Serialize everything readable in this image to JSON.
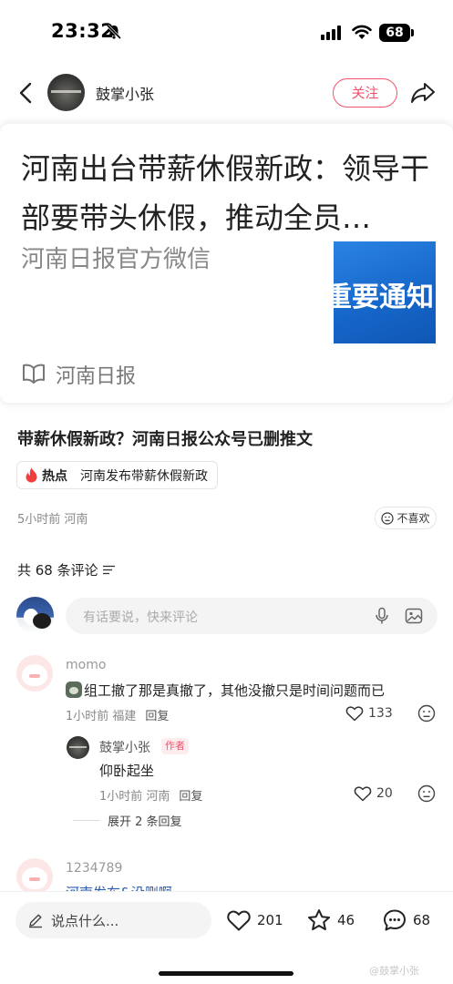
{
  "status_bar": {
    "time": "23:32",
    "battery": "68"
  },
  "header": {
    "author_name": "鼓掌小张",
    "follow_label": "关注"
  },
  "link_card": {
    "title": "河南出台带薪休假新政：领导干部要带头休假，推动全员…",
    "source": "河南日报官方微信",
    "thumb_text": "重要通知",
    "footer_label": "河南日报"
  },
  "post": {
    "title": "带薪休假新政？河南日报公众号已删推文",
    "hot_label": "热点",
    "hot_topic": "河南发布带薪休假新政",
    "meta": "5小时前 河南",
    "dislike_label": "不喜欢"
  },
  "comments_section": {
    "count_label": "共 68 条评论",
    "input_placeholder": "有话要说，快来评论"
  },
  "comments": [
    {
      "name": "momo",
      "text": "组工撤了那是真撤了，其他没撤只是时间问题而已",
      "meta": "1小时前 福建",
      "reply_label": "回复",
      "likes": "133"
    }
  ],
  "reply": {
    "name": "鼓掌小张",
    "badge": "作者",
    "text": "仰卧起坐",
    "meta": "1小时前 河南",
    "reply_label": "回复",
    "likes": "20"
  },
  "expand_label": "展开 2 条回复",
  "comment2": {
    "name": "1234789",
    "text": "河南发布&没删啊"
  },
  "bottom_bar": {
    "input_placeholder": "说点什么...",
    "likes": "201",
    "stars": "46",
    "comments": "68"
  },
  "watermark": "@鼓掌小张",
  "colors": {
    "accent": "#f0536b",
    "text": "#222222",
    "muted": "#888888"
  }
}
